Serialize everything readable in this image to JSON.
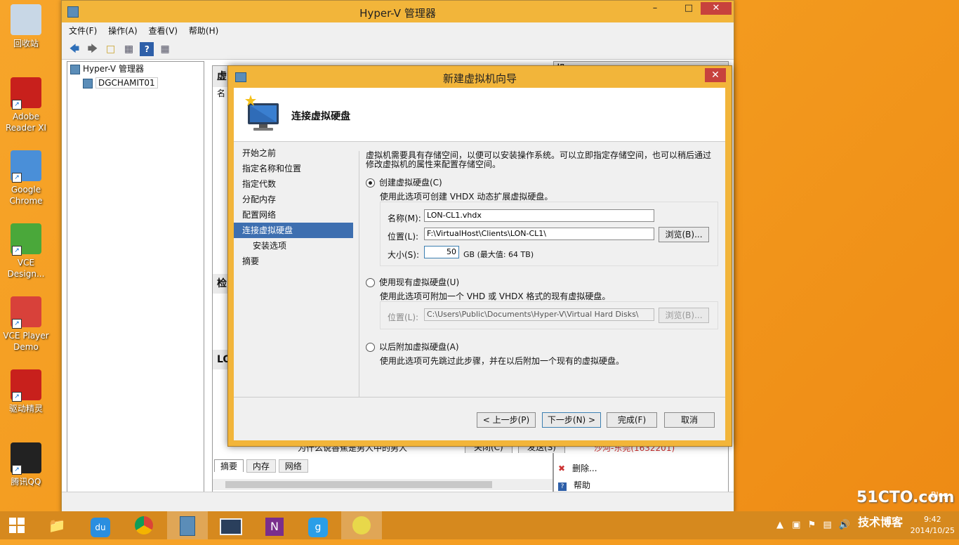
{
  "desktop": {
    "icons": [
      {
        "label": "回收站",
        "icon": "recycle-bin-icon",
        "color": "#c8d7e6"
      },
      {
        "label": "Adobe Reader XI",
        "icon": "adobe-reader-icon",
        "color": "#c8201c"
      },
      {
        "label": "Google Chrome",
        "icon": "chrome-icon",
        "color": "#4a8fd8"
      },
      {
        "label": "VCE Design...",
        "icon": "vce-designer-icon",
        "color": "#4aa83a"
      },
      {
        "label": "VCE Player Demo",
        "icon": "vce-player-icon",
        "color": "#d8413a"
      },
      {
        "label": "驱动精灵",
        "icon": "driver-genius-icon",
        "color": "#c8201c"
      },
      {
        "label": "腾讯QQ",
        "icon": "qq-icon",
        "color": "#222222"
      }
    ]
  },
  "hyperv": {
    "title": "Hyper-V 管理器",
    "menu": [
      "文件(F)",
      "操作(A)",
      "查看(V)",
      "帮助(H)"
    ],
    "tree": [
      "Hyper-V 管理器",
      "DGCHAMIT01"
    ],
    "mid_partial": [
      "虚",
      "名",
      "检",
      "LO"
    ],
    "bottom_tabs": [
      "摘要",
      "内存",
      "网络"
    ],
    "right_partial": [
      "操"
    ],
    "actions": [
      "删除...",
      "帮助"
    ],
    "behind_text": "为什么说香蕉是男人中的男人",
    "behind_buttons": [
      "关闭(C)",
      "发送(S)"
    ],
    "behind_link": "沙河-东莞(1632201)"
  },
  "wizard": {
    "title": "新建虚拟机向导",
    "heading": "连接虚拟硬盘",
    "steps": [
      "开始之前",
      "指定名称和位置",
      "指定代数",
      "分配内存",
      "配置网络",
      "连接虚拟硬盘",
      "安装选项",
      "摘要"
    ],
    "intro_line1": "虚拟机需要具有存储空间，以便可以安装操作系统。可以立即指定存储空间，也可以稍后通过",
    "intro_line2": "修改虚拟机的属性来配置存储空间。",
    "opt1": {
      "label": "创建虚拟硬盘(C)",
      "desc": "使用此选项可创建 VHDX 动态扩展虚拟硬盘。",
      "name_label": "名称(M):",
      "name_value": "LON-CL1.vhdx",
      "loc_label": "位置(L):",
      "loc_value": "F:\\VirtualHost\\Clients\\LON-CL1\\",
      "browse": "浏览(B)...",
      "size_label": "大小(S):",
      "size_value": "50",
      "size_unit": "GB (最大值: 64 TB)"
    },
    "opt2": {
      "label": "使用现有虚拟硬盘(U)",
      "desc": "使用此选项可附加一个 VHD 或 VHDX 格式的现有虚拟硬盘。",
      "loc_label": "位置(L):",
      "loc_value": "C:\\Users\\Public\\Documents\\Hyper-V\\Virtual Hard Disks\\",
      "browse": "浏览(B)..."
    },
    "opt3": {
      "label": "以后附加虚拟硬盘(A)",
      "desc": "使用此选项可先跳过此步骤，并在以后附加一个现有的虚拟硬盘。"
    },
    "buttons": {
      "prev": "< 上一步(P)",
      "next": "下一步(N) >",
      "finish": "完成(F)",
      "cancel": "取消"
    }
  },
  "taskbar": {
    "date": "2014/10/25",
    "time": "9:42",
    "watermark": "51CTO.com",
    "watermark_sub": "技术博客",
    "watermark_blog": "Blog"
  }
}
